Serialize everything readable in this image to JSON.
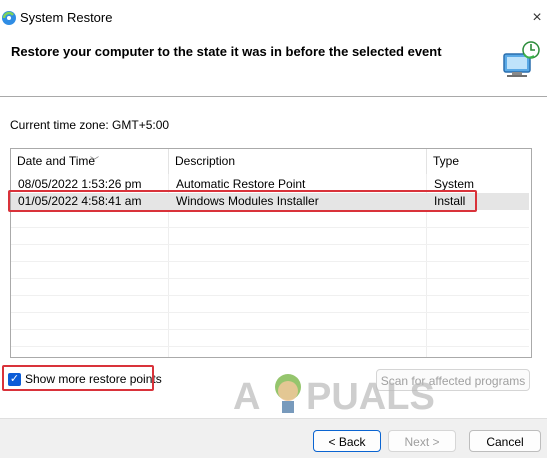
{
  "window": {
    "title": "System Restore",
    "close_glyph": "×"
  },
  "header": {
    "title": "Restore your computer to the state it was in before the selected event"
  },
  "timezone": "Current time zone: GMT+5:00",
  "table": {
    "columns": [
      "Date and Time",
      "Description",
      "Type"
    ],
    "rows": [
      {
        "date": "08/05/2022 1:53:26 pm",
        "description": "Automatic Restore Point",
        "type": "System",
        "selected": false
      },
      {
        "date": "01/05/2022 4:58:41 am",
        "description": "Windows Modules Installer",
        "type": "Install",
        "selected": true
      }
    ]
  },
  "checkbox": {
    "label": "Show more restore points",
    "checked": true
  },
  "buttons": {
    "scan": "Scan for affected programs",
    "back": "< Back",
    "next": "Next >",
    "cancel": "Cancel"
  },
  "watermark": "APPUALS",
  "colors": {
    "highlight": "#d9323a",
    "selection": "#e5e5e5",
    "checkbox": "#0b5cd7"
  }
}
